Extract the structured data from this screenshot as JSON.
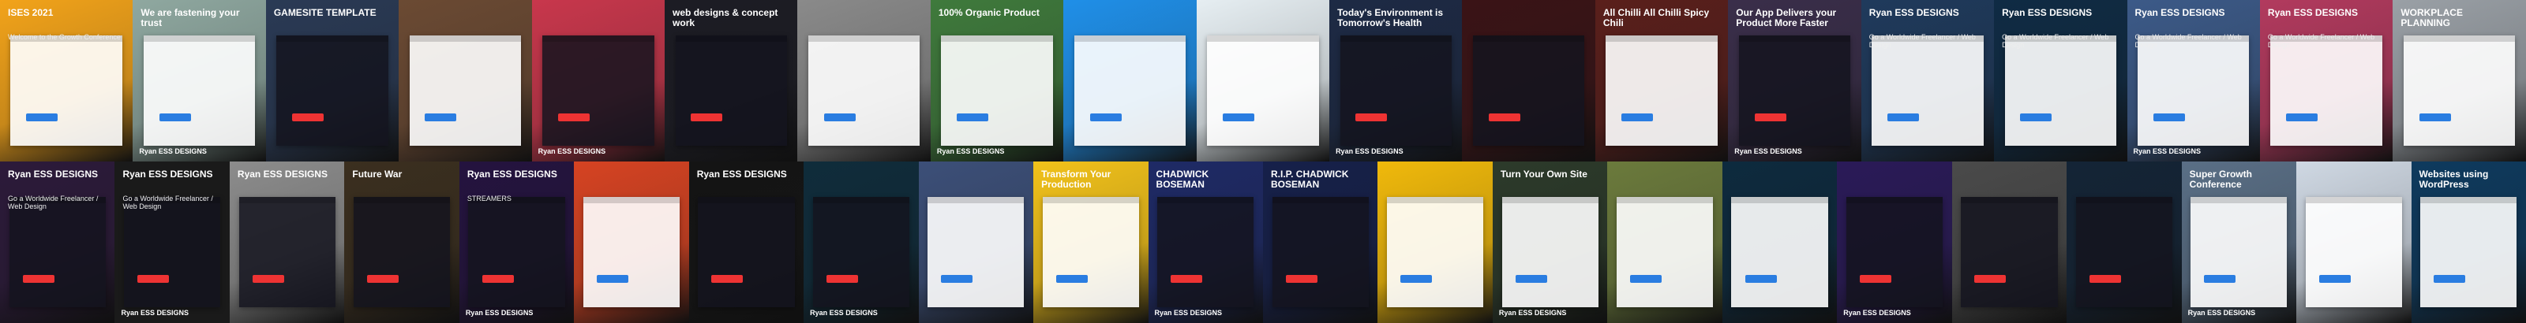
{
  "row1": [
    {
      "name": "tile-conference-1",
      "bg": "#f2a31a",
      "caption": "ISES 2021",
      "sub": "Welcome to the Growth Conference",
      "dark": false
    },
    {
      "name": "tile-fastening",
      "bg": "#8fa8a0",
      "caption": "We are fastening your trust",
      "sub": "",
      "dark": false
    },
    {
      "name": "tile-gamesite",
      "bg": "#2a3a55",
      "caption": "GAMESITE TEMPLATE",
      "sub": "",
      "dark": true
    },
    {
      "name": "tile-food",
      "bg": "#6b4a33",
      "caption": "",
      "sub": "",
      "dark": false
    },
    {
      "name": "tile-bull",
      "bg": "#c8374c",
      "caption": "",
      "sub": "",
      "dark": true
    },
    {
      "name": "tile-concept",
      "bg": "#1c1c24",
      "caption": "web designs & concept work",
      "sub": "",
      "dark": true
    },
    {
      "name": "tile-architecture",
      "bg": "#8a8a8a",
      "caption": "",
      "sub": "",
      "dark": false
    },
    {
      "name": "tile-nature",
      "bg": "#3f7a3c",
      "caption": "100% Organic Product",
      "sub": "",
      "dark": false
    },
    {
      "name": "tile-blue-site",
      "bg": "#1f8fe8",
      "caption": "",
      "sub": "",
      "dark": false
    },
    {
      "name": "tile-green-app",
      "bg": "#e6eef2",
      "caption": "",
      "sub": "",
      "dark": false
    },
    {
      "name": "tile-tomorrow",
      "bg": "#1d2a45",
      "caption": "Today's Environment is Tomorrow's Health",
      "sub": "",
      "dark": true
    },
    {
      "name": "tile-dark-red",
      "bg": "#3a1316",
      "caption": "",
      "sub": "",
      "dark": true
    },
    {
      "name": "tile-chili",
      "bg": "#5a1f1b",
      "caption": "All Chilli All Chilli Spicy Chili",
      "sub": "",
      "dark": false
    },
    {
      "name": "tile-app",
      "bg": "#3a2e4a",
      "caption": "Our App Delivers your Product More Faster",
      "sub": "",
      "dark": true
    },
    {
      "name": "tile-ryan-1",
      "bg": "#1f3a5c",
      "caption": "Ryan ESS DESIGNS",
      "sub": "Go a Worldwide Freelancer / Web Design",
      "dark": false
    },
    {
      "name": "tile-ryan-2",
      "bg": "#0f2b44",
      "caption": "Ryan ESS DESIGNS",
      "sub": "Go a Worldwide Freelancer / Web Design",
      "dark": false
    },
    {
      "name": "tile-ryan-3",
      "bg": "#3c5a88",
      "caption": "Ryan ESS DESIGNS",
      "sub": "Go a Worldwide Freelancer / Web Design",
      "dark": false
    },
    {
      "name": "tile-ryan-4",
      "bg": "#b23a5e",
      "caption": "Ryan ESS DESIGNS",
      "sub": "Go a Worldwide Freelancer / Web Design",
      "dark": false
    },
    {
      "name": "tile-planning",
      "bg": "#9aa0a6",
      "caption": "WORKPLACE PLANNING",
      "sub": "",
      "dark": false
    }
  ],
  "row2": [
    {
      "name": "tile-ryan-5",
      "bg": "#2c1a3a",
      "caption": "Ryan ESS DESIGNS",
      "sub": "Go a Worldwide Freelancer / Web Design",
      "dark": true
    },
    {
      "name": "tile-ryan-6",
      "bg": "#555",
      "caption": "Ryan ESS DESIGNS",
      "sub": "Go a Worldwide Freelancer / Web Design",
      "dark": true
    },
    {
      "name": "tile-bike",
      "bg": "#8c8c8c",
      "caption": "Ryan ESS DESIGNS",
      "sub": "",
      "dark": true
    },
    {
      "name": "tile-future",
      "bg": "#3b2f1f",
      "caption": "Future War",
      "sub": "",
      "dark": true
    },
    {
      "name": "tile-streamers",
      "bg": "#24133f",
      "caption": "Ryan ESS DESIGNS",
      "sub": "STREAMERS",
      "dark": true
    },
    {
      "name": "tile-parrot",
      "bg": "#d64322",
      "caption": "",
      "sub": "",
      "dark": false
    },
    {
      "name": "tile-ryan-7",
      "bg": "#141414",
      "caption": "Ryan ESS DESIGNS",
      "sub": "",
      "dark": true
    },
    {
      "name": "tile-network",
      "bg": "#0f2c3b",
      "caption": "",
      "sub": "",
      "dark": true
    },
    {
      "name": "tile-workspace",
      "bg": "#3c4f78",
      "caption": "",
      "sub": "",
      "dark": false
    },
    {
      "name": "tile-yellow",
      "bg": "#f2c21a",
      "caption": "Transform Your Production",
      "sub": "",
      "dark": false
    },
    {
      "name": "tile-chadwick-1",
      "bg": "#1e2a66",
      "caption": "CHADWICK BOSEMAN",
      "sub": "",
      "dark": true
    },
    {
      "name": "tile-chadwick-2",
      "bg": "#16204a",
      "caption": "R.I.P. CHADWICK BOSEMAN",
      "sub": "",
      "dark": true
    },
    {
      "name": "tile-yellow-2",
      "bg": "#f0b90b",
      "caption": "",
      "sub": "",
      "dark": false
    },
    {
      "name": "tile-green-site",
      "bg": "#2c3a2a",
      "caption": "Turn Your Own Site",
      "sub": "",
      "dark": false
    },
    {
      "name": "tile-stairs",
      "bg": "#6b7a3c",
      "caption": "",
      "sub": "",
      "dark": false
    },
    {
      "name": "tile-watch",
      "bg": "#0d2a3e",
      "caption": "",
      "sub": "",
      "dark": false
    },
    {
      "name": "tile-purple",
      "bg": "#2a1a58",
      "caption": "",
      "sub": "",
      "dark": true
    },
    {
      "name": "tile-dark-gray",
      "bg": "#4a4a4a",
      "caption": "",
      "sub": "",
      "dark": true
    },
    {
      "name": "tile-blue-blur",
      "bg": "#142436",
      "caption": "",
      "sub": "",
      "dark": true
    },
    {
      "name": "tile-conference-2",
      "bg": "#5a6f86",
      "caption": "Super Growth Conference",
      "sub": "",
      "dark": false
    },
    {
      "name": "tile-chart",
      "bg": "#cfd8e3",
      "caption": "",
      "sub": "",
      "dark": false
    },
    {
      "name": "tile-city",
      "bg": "#0e3a5e",
      "caption": "Websites using WordPress",
      "sub": "",
      "dark": false
    }
  ],
  "logo_text": "Ryan ESS DESIGNS"
}
